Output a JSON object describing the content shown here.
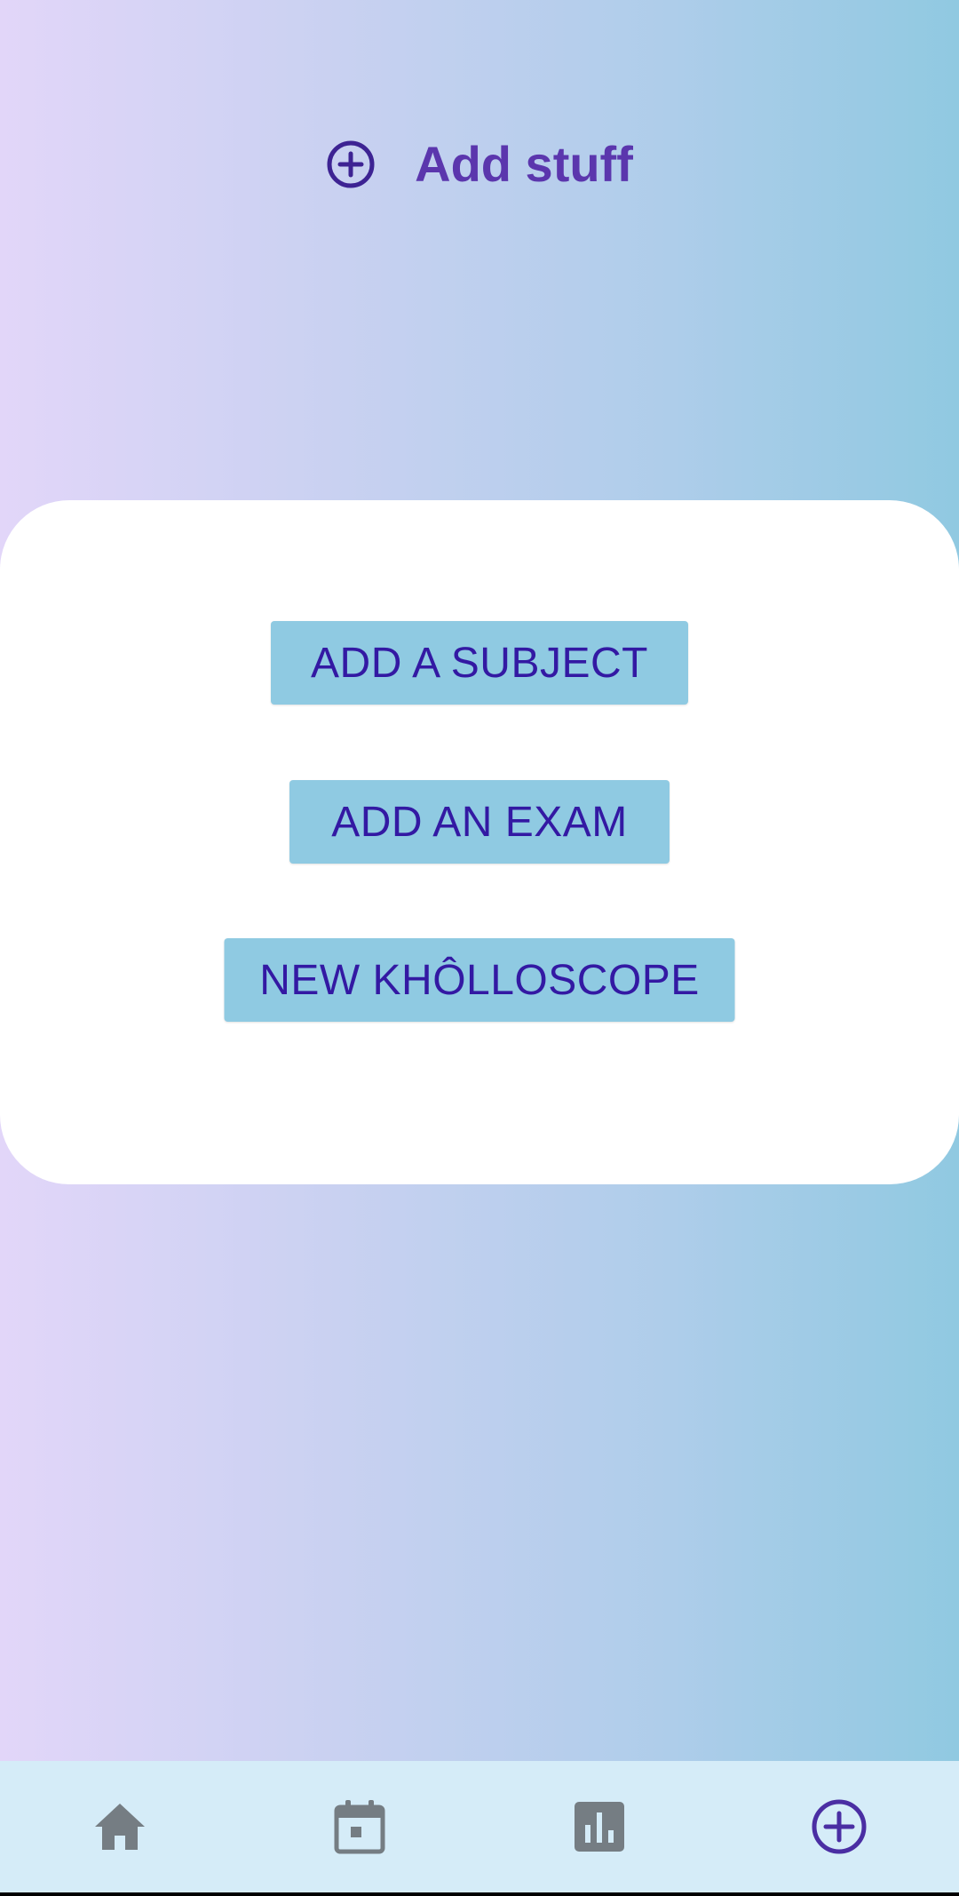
{
  "header": {
    "title": "Add stuff",
    "icon": "add-circle-icon"
  },
  "actions": {
    "add_subject_label": "ADD A SUBJECT",
    "add_exam_label": "ADD AN EXAM",
    "new_kholloscope_label": "NEW KHÔLLOSCOPE"
  },
  "bottom_nav": {
    "items": [
      {
        "icon": "home-icon",
        "active": false
      },
      {
        "icon": "calendar-icon",
        "active": false
      },
      {
        "icon": "bar-chart-icon",
        "active": false
      },
      {
        "icon": "add-circle-icon",
        "active": true
      }
    ]
  },
  "colors": {
    "accent": "#5b36ad",
    "button_background": "#8fcae2",
    "button_text": "#3319a3",
    "nav_background": "#d5ecf8",
    "nav_inactive_icon": "#757d83",
    "nav_active_icon": "#4a2ea3",
    "gradient_left": "#e2d6f9",
    "gradient_right": "#90c9e1"
  }
}
